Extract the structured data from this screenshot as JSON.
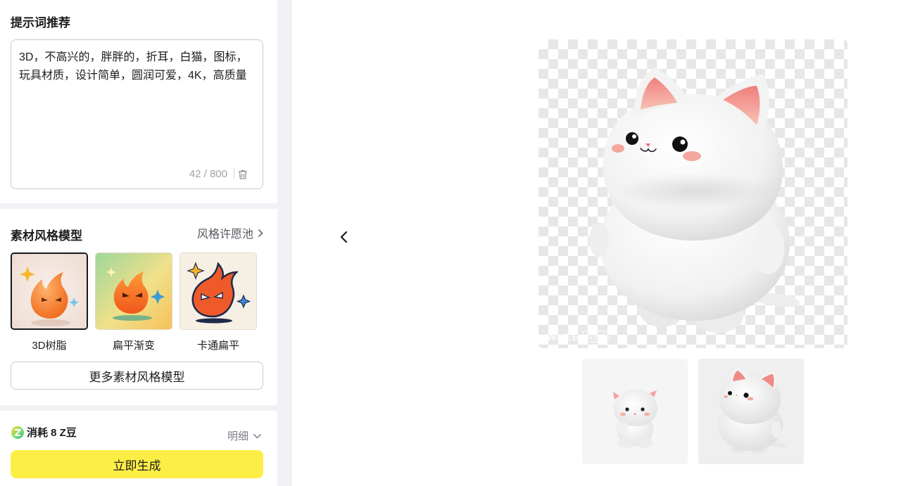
{
  "prompt_section": {
    "title": "提示词推荐",
    "text": "3D，不高兴的，胖胖的，折耳，白猫，图标，玩具材质，设计简单，圆润可爱，4K，高质量",
    "counter": "42 / 800",
    "delete_icon": "trash-icon"
  },
  "style_section": {
    "title": "素材风格模型",
    "link_label": "风格许愿池",
    "cards": [
      {
        "label": "3D树脂",
        "selected": true
      },
      {
        "label": "扁平渐变",
        "selected": false
      },
      {
        "label": "卡通扁平",
        "selected": false
      }
    ],
    "more_button": "更多素材风格模型"
  },
  "generate_section": {
    "cost_label": "消耗 8 Z豆",
    "detail_label": "明细",
    "generate_button": "立即生成"
  },
  "preview": {
    "watermark": "WHEE",
    "watermark_badge": "AI生成",
    "back_icon": "chevron-left-icon"
  },
  "colors": {
    "accent_yellow": "#fdee45",
    "panel_bg": "#f1f2f5",
    "border": "#c8cace"
  }
}
